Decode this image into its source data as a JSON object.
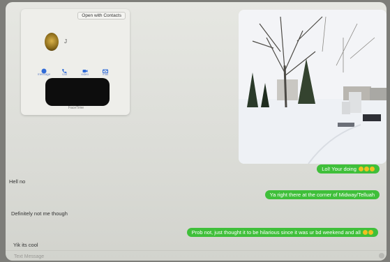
{
  "contact_card": {
    "open_with_contacts": "Open with Contacts",
    "name": "J",
    "actions": [
      {
        "label": "message",
        "icon": "message-icon"
      },
      {
        "label": "call",
        "icon": "phone-icon"
      },
      {
        "label": "video",
        "icon": "video-icon"
      },
      {
        "label": "mail",
        "icon": "mail-icon"
      }
    ],
    "sub_label": "FaceTime"
  },
  "messages": [
    {
      "direction": "out",
      "text": "Lol! Your doing",
      "emoji_count": 3
    },
    {
      "direction": "in",
      "text": "Hell no"
    },
    {
      "direction": "out",
      "text": "Ya right there at the corner of Midway/Telluah"
    },
    {
      "direction": "in",
      "text": "Definitely not me though"
    },
    {
      "direction": "out",
      "text": "Prob not, just thought it to be hilarious since it was ur bd weekend and all",
      "emoji_count": 2
    },
    {
      "direction": "in",
      "text": "Yik its cool"
    }
  ],
  "input": {
    "placeholder": "Text Message"
  },
  "colors": {
    "outgoing_bubble": "#3fbf3a",
    "incoming_text": "#333333",
    "action_icon": "#2f6bd8"
  }
}
